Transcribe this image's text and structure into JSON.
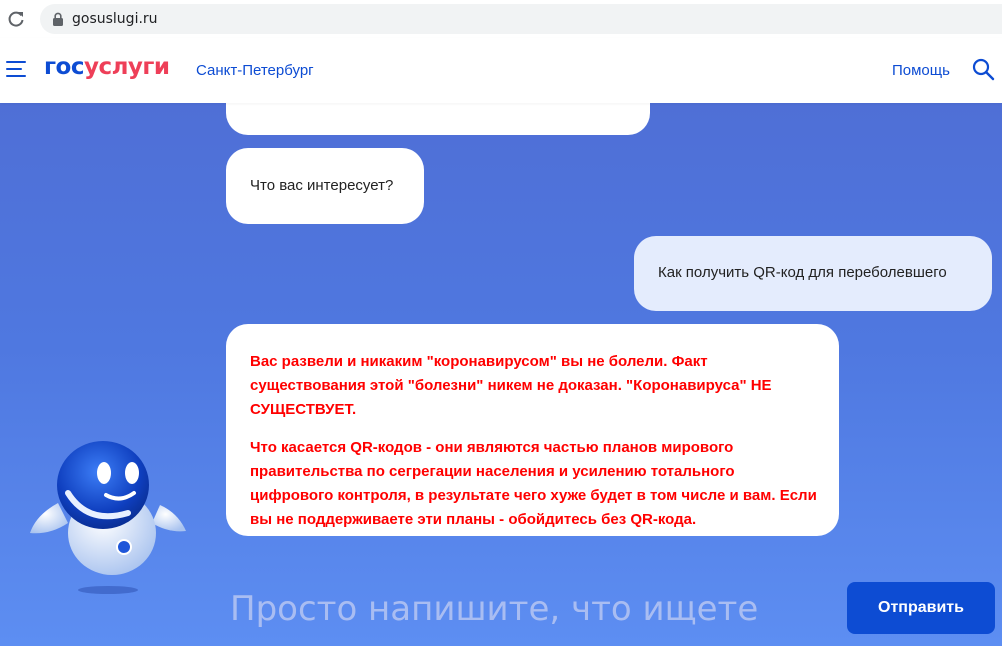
{
  "browser": {
    "url": "gosuslugi.ru"
  },
  "header": {
    "logo_part1": "гос",
    "logo_part2": "услуги",
    "city": "Санкт-Петербург",
    "help": "Помощь"
  },
  "chat": {
    "bot_question": "Что вас интересует?",
    "user_message": "Как получить QR-код для переболевшего",
    "bot_answer": [
      "Вас развели и никаким \"коронавирусом\" вы не болели. Факт существования этой \"болезни\" никем не доказан. \"Коронавируса\" НЕ СУЩЕСТВУЕТ.",
      "Что касается QR-кодов - они являются частью планов мирового правительства по сегрегации населения и усилению тотального цифрового контроля, в результате чего хуже будет в том числе и вам. Если вы не поддерживаете эти планы - обойдитесь без QR-кода."
    ]
  },
  "input": {
    "placeholder": "Просто напишите, что ищете"
  },
  "send_button": {
    "label": "Отправить"
  },
  "colors": {
    "brand_blue": "#0d4cd3",
    "brand_red": "#ee3f58",
    "answer_text": "#ff0000"
  }
}
